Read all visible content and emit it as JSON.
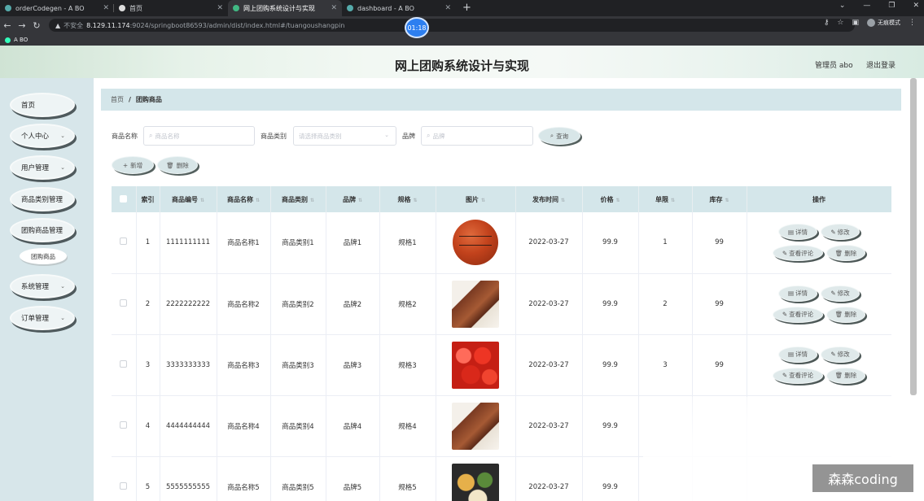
{
  "browser": {
    "tabs": [
      {
        "label": "orderCodegen - A BO",
        "active": false
      },
      {
        "label": "首页",
        "active": false
      },
      {
        "label": "网上团购系统设计与实现",
        "active": true
      },
      {
        "label": "dashboard - A BO",
        "active": false
      }
    ],
    "new_tab": "+",
    "insecure_label": "不安全",
    "url_host": "8.129.11.174",
    "url_rest": ":9024/springboot86593/admin/dist/index.html#/tuangoushangpin",
    "profile_label": "无痕模式",
    "timer": "01:18",
    "bookmark": "A BO"
  },
  "header": {
    "title": "网上团购系统设计与实现",
    "user": "管理员 abo",
    "logout": "退出登录"
  },
  "sidebar": {
    "items": [
      {
        "label": "首页",
        "has_chevron": false
      },
      {
        "label": "个人中心",
        "has_chevron": true
      },
      {
        "label": "用户管理",
        "has_chevron": true
      },
      {
        "label": "商品类别管理",
        "has_chevron": false
      },
      {
        "label": "团购商品管理",
        "has_chevron": false
      },
      {
        "label": "系统管理",
        "has_chevron": true
      },
      {
        "label": "订单管理",
        "has_chevron": true
      }
    ],
    "submenu": "团购商品"
  },
  "breadcrumb": {
    "home": "首页",
    "current": "团购商品"
  },
  "filters": {
    "name_label": "商品名称",
    "name_placeholder": "商品名称",
    "category_label": "商品类别",
    "category_placeholder": "请选择商品类别",
    "brand_label": "品牌",
    "brand_placeholder": "品牌",
    "search_button": "查询"
  },
  "toolbar": {
    "add": "新增",
    "delete": "删除"
  },
  "table": {
    "columns": [
      "索引",
      "商品编号",
      "商品名称",
      "商品类别",
      "品牌",
      "规格",
      "图片",
      "发布时间",
      "价格",
      "单限",
      "库存",
      "操作"
    ],
    "rows": [
      {
        "index": "1",
        "code": "1111111111",
        "name": "商品名称1",
        "category": "商品类别1",
        "brand": "品牌1",
        "spec": "规格1",
        "image": "basketball",
        "date": "2022-03-27",
        "price": "99.9",
        "limit": "1",
        "stock": "99"
      },
      {
        "index": "2",
        "code": "2222222222",
        "name": "商品名称2",
        "category": "商品类别2",
        "brand": "品牌2",
        "spec": "规格2",
        "image": "meat-plate",
        "date": "2022-03-27",
        "price": "99.9",
        "limit": "2",
        "stock": "99"
      },
      {
        "index": "3",
        "code": "3333333333",
        "name": "商品名称3",
        "category": "商品类别3",
        "brand": "品牌3",
        "spec": "规格3",
        "image": "tomatoes",
        "date": "2022-03-27",
        "price": "99.9",
        "limit": "3",
        "stock": "99"
      },
      {
        "index": "4",
        "code": "4444444444",
        "name": "商品名称4",
        "category": "商品类别4",
        "brand": "品牌4",
        "spec": "规格4",
        "image": "meat-plate",
        "date": "2022-03-27",
        "price": "99.9",
        "limit": "",
        "stock": ""
      },
      {
        "index": "5",
        "code": "5555555555",
        "name": "商品名称5",
        "category": "商品类别5",
        "brand": "品牌5",
        "spec": "规格5",
        "image": "noodle-bowls",
        "date": "2022-03-27",
        "price": "99.9",
        "limit": "",
        "stock": ""
      }
    ],
    "actions": {
      "detail": "详情",
      "edit": "修改",
      "comments": "查看评论",
      "delete": "删除"
    }
  },
  "watermark": "森森coding"
}
